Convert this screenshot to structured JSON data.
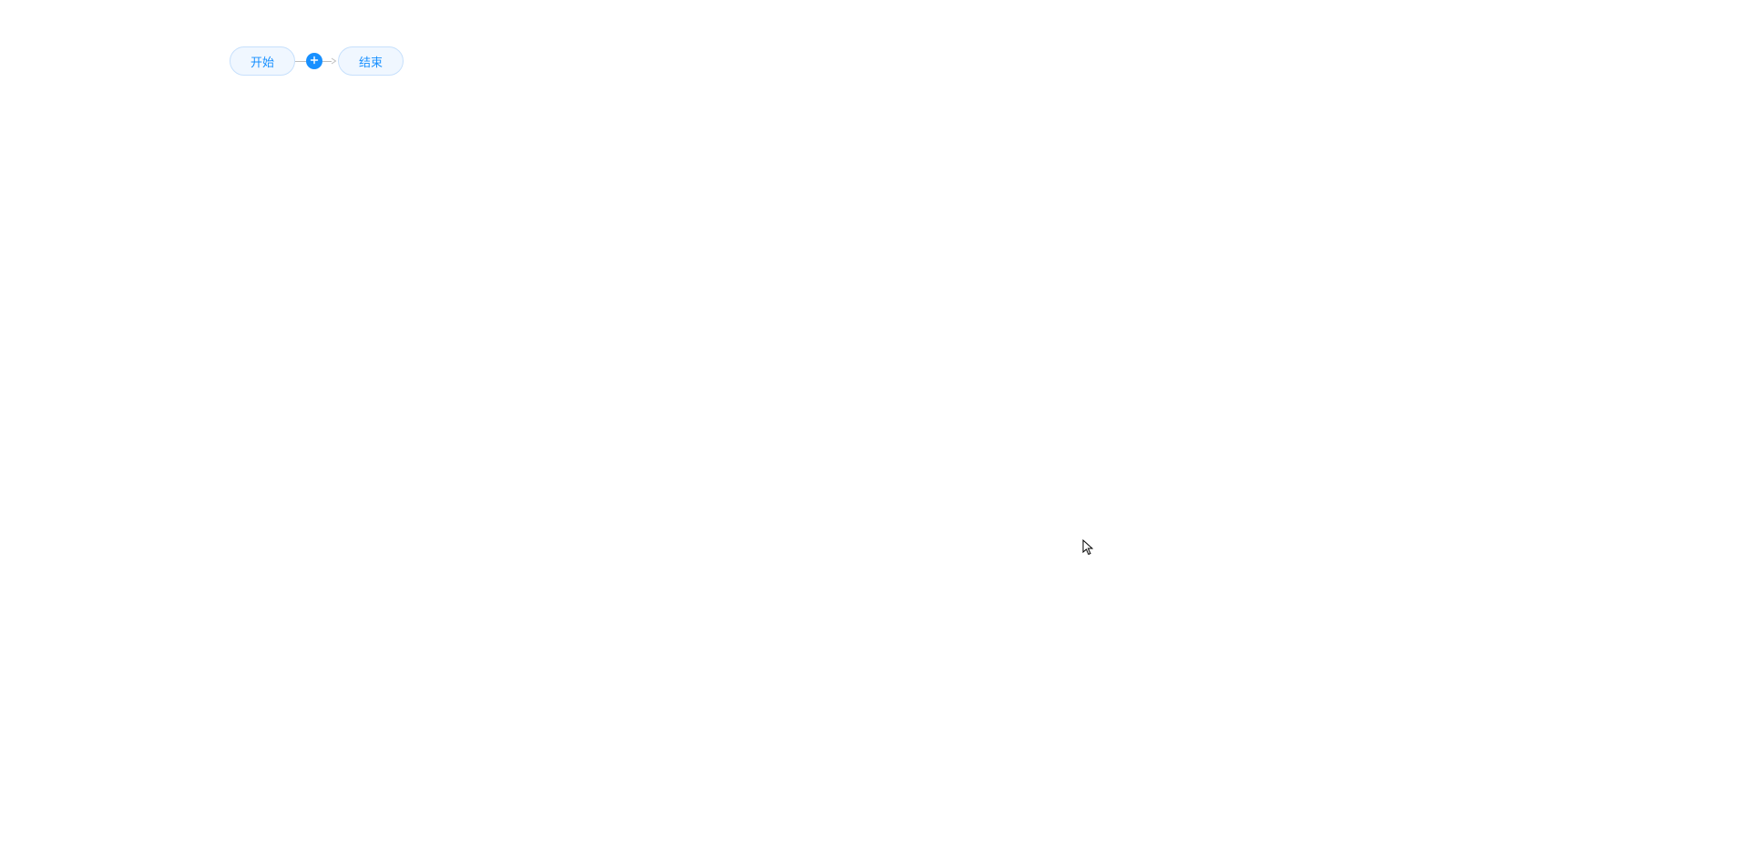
{
  "flow": {
    "start_node_label": "开始",
    "end_node_label": "结束"
  },
  "colors": {
    "node_bg": "#f0f7ff",
    "node_border": "#c7e0fc",
    "node_text": "#1890ff",
    "add_button_bg": "#1890ff",
    "connector": "#bfbfbf"
  }
}
